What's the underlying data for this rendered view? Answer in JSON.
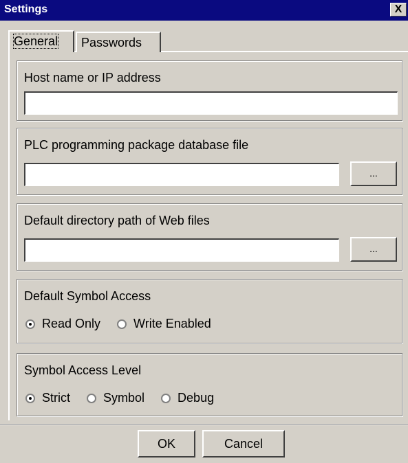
{
  "window": {
    "title": "Settings",
    "close_label": "X"
  },
  "tabs": [
    {
      "label": "General",
      "selected": true
    },
    {
      "label": "Passwords",
      "selected": false
    }
  ],
  "host": {
    "label": "Host name or IP address",
    "value": ""
  },
  "plc": {
    "label": "PLC programming package database file",
    "value": "",
    "browse_label": "..."
  },
  "webdir": {
    "label": "Default directory path of Web files",
    "value": "",
    "browse_label": "..."
  },
  "symbol_access": {
    "label": "Default Symbol Access",
    "options": [
      {
        "label": "Read Only",
        "checked": true
      },
      {
        "label": "Write Enabled",
        "checked": false
      }
    ]
  },
  "access_level": {
    "label": "Symbol Access Level",
    "options": [
      {
        "label": "Strict",
        "checked": true
      },
      {
        "label": "Symbol",
        "checked": false
      },
      {
        "label": "Debug",
        "checked": false
      }
    ]
  },
  "buttons": {
    "ok": "OK",
    "cancel": "Cancel"
  },
  "colors": {
    "titlebar": "#0a0a80",
    "face": "#d4d0c8"
  }
}
